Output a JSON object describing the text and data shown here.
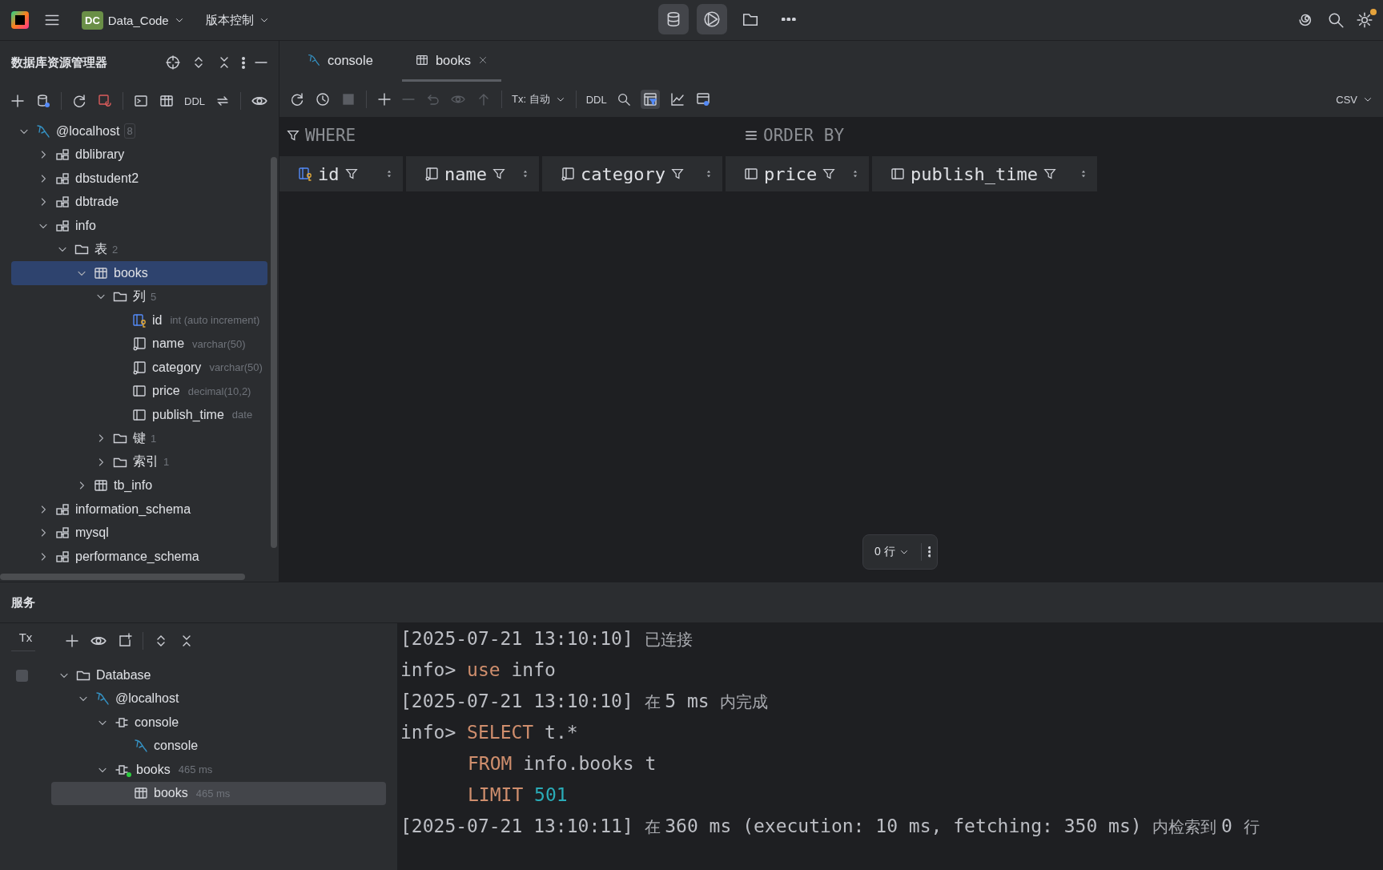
{
  "title_bar": {
    "project_badge": "DC",
    "project_name": "Data_Code",
    "vcs_menu": "版本控制",
    "database_button": {
      "selected": true
    },
    "run_button": {
      "selected": true
    }
  },
  "explorer": {
    "title": "数据库资源管理器",
    "toolbar_label": "DDL",
    "tree": [
      {
        "kind": "connection",
        "label": "@localhost",
        "count": "8",
        "expanded": true,
        "selected": false,
        "children": [
          {
            "kind": "schema",
            "label": "dblibrary",
            "expanded": false,
            "selected": false
          },
          {
            "kind": "schema",
            "label": "dbstudent2",
            "expanded": false,
            "selected": false
          },
          {
            "kind": "schema",
            "label": "dbtrade",
            "expanded": false,
            "selected": false
          },
          {
            "kind": "schema",
            "label": "info",
            "expanded": true,
            "selected": false,
            "children": [
              {
                "kind": "folder",
                "label": "表",
                "count": "2",
                "expanded": true,
                "selected": false,
                "children": [
                  {
                    "kind": "table",
                    "label": "books",
                    "expanded": true,
                    "selected": true,
                    "children": [
                      {
                        "kind": "folder",
                        "label": "列",
                        "count": "5",
                        "expanded": true,
                        "selected": false,
                        "children": [
                          {
                            "kind": "key_column",
                            "label": "id",
                            "detail": "int (auto increment)",
                            "selected": false
                          },
                          {
                            "kind": "column",
                            "label": "name",
                            "detail": "varchar(50)",
                            "selected": false
                          },
                          {
                            "kind": "column",
                            "label": "category",
                            "detail": "varchar(50)",
                            "selected": false
                          },
                          {
                            "kind": "plain_column",
                            "label": "price",
                            "detail": "decimal(10,2)",
                            "selected": false
                          },
                          {
                            "kind": "plain_column",
                            "label": "publish_time",
                            "detail": "date",
                            "selected": false
                          }
                        ]
                      },
                      {
                        "kind": "folder",
                        "label": "键",
                        "count": "1",
                        "expanded": false,
                        "selected": false
                      },
                      {
                        "kind": "folder",
                        "label": "索引",
                        "count": "1",
                        "expanded": false,
                        "selected": false
                      }
                    ]
                  },
                  {
                    "kind": "table",
                    "label": "tb_info",
                    "expanded": false,
                    "selected": false
                  }
                ]
              }
            ]
          },
          {
            "kind": "schema",
            "label": "information_schema",
            "expanded": false,
            "selected": false
          },
          {
            "kind": "schema",
            "label": "mysql",
            "expanded": false,
            "selected": false
          },
          {
            "kind": "schema",
            "label": "performance_schema",
            "expanded": false,
            "selected": false
          }
        ]
      }
    ]
  },
  "editor": {
    "tabs": [
      {
        "kind": "console",
        "label": "console",
        "selected": false,
        "closable": false
      },
      {
        "kind": "table",
        "label": "books",
        "selected": true,
        "closable": true
      }
    ],
    "toolbar": {
      "tx_mode": "Tx: 自动",
      "ddl": "DDL",
      "export_format": "CSV",
      "filter_toggle": {
        "selected": true
      }
    },
    "where_label": "WHERE",
    "order_by_label": "ORDER BY",
    "columns": [
      {
        "kind": "key_column",
        "name": "id"
      },
      {
        "kind": "column",
        "name": "name"
      },
      {
        "kind": "column",
        "name": "category"
      },
      {
        "kind": "plain_column",
        "name": "price"
      },
      {
        "kind": "plain_column",
        "name": "publish_time"
      }
    ],
    "row_count": "0 行"
  },
  "services": {
    "title": "服务",
    "tx_label": "Tx",
    "tree": [
      {
        "kind": "folder",
        "label": "Database",
        "expanded": true,
        "selected": false,
        "children": [
          {
            "kind": "connection",
            "label": "@localhost",
            "expanded": true,
            "selected": false,
            "children": [
              {
                "kind": "session",
                "label": "console",
                "expanded": true,
                "selected": false,
                "active": false,
                "children": [
                  {
                    "kind": "console",
                    "label": "console",
                    "selected": false
                  }
                ]
              },
              {
                "kind": "session",
                "label": "books",
                "detail": "465 ms",
                "expanded": true,
                "selected": false,
                "active": true,
                "children": [
                  {
                    "kind": "table",
                    "label": "books",
                    "detail": "465 ms",
                    "selected": true
                  }
                ]
              }
            ]
          }
        ]
      }
    ]
  },
  "console_output": [
    {
      "indented": false,
      "segments": [
        {
          "kind": "plain",
          "text": "[2025-07-21 13:10:10] "
        },
        {
          "kind": "message",
          "text": "已连接"
        }
      ]
    },
    {
      "indented": false,
      "segments": [
        {
          "kind": "plain",
          "text": "info> "
        },
        {
          "kind": "keyword",
          "text": "use"
        },
        {
          "kind": "plain",
          "text": " info"
        }
      ]
    },
    {
      "indented": false,
      "segments": [
        {
          "kind": "plain",
          "text": "[2025-07-21 13:10:10] "
        },
        {
          "kind": "message",
          "text": "在 "
        },
        {
          "kind": "plain",
          "text": "5 ms "
        },
        {
          "kind": "message",
          "text": "内完成"
        }
      ]
    },
    {
      "indented": false,
      "segments": [
        {
          "kind": "plain",
          "text": "info> "
        },
        {
          "kind": "keyword",
          "text": "SELECT"
        },
        {
          "kind": "plain",
          "text": " t.*"
        }
      ]
    },
    {
      "indented": true,
      "segments": [
        {
          "kind": "keyword",
          "text": "FROM"
        },
        {
          "kind": "plain",
          "text": " info.books t"
        }
      ]
    },
    {
      "indented": true,
      "segments": [
        {
          "kind": "keyword",
          "text": "LIMIT"
        },
        {
          "kind": "number",
          "text": "501"
        }
      ]
    },
    {
      "indented": false,
      "segments": [
        {
          "kind": "plain",
          "text": "[2025-07-21 13:10:11] "
        },
        {
          "kind": "message",
          "text": "在 "
        },
        {
          "kind": "plain",
          "text": "360 ms (execution: 10 ms, fetching: 350 ms) "
        },
        {
          "kind": "message",
          "text": "内检索到 "
        },
        {
          "kind": "plain",
          "text": "0 "
        },
        {
          "kind": "message",
          "text": "行"
        }
      ]
    }
  ]
}
